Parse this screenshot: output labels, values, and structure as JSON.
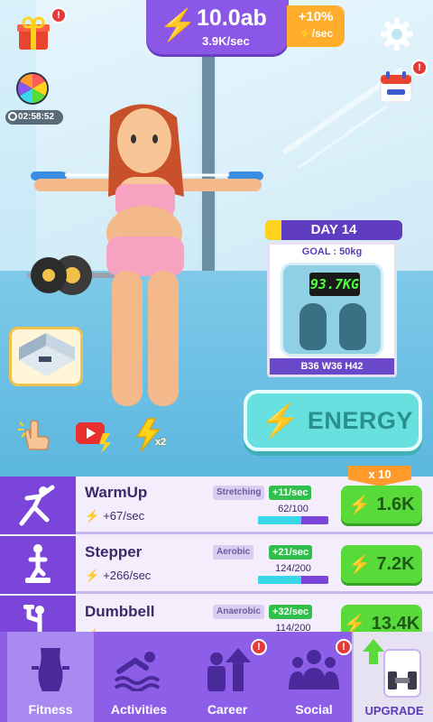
{
  "top_bar": {
    "energy_value": "10.0ab",
    "energy_rate": "3.9K/sec",
    "bonus_percent": "+10%",
    "bonus_per_sec": "/sec"
  },
  "timer": {
    "value": "02:58:52"
  },
  "day_card": {
    "day_label": "DAY 14",
    "day_progress_fraction": 0.12,
    "goal": "GOAL : 50kg",
    "scale_reading": "93.7KG",
    "measurements": "B36 W36 H42"
  },
  "energy_button": {
    "label": "ENERGY"
  },
  "multiplier": {
    "label": "x 10"
  },
  "mini_buttons": [
    {
      "name": "tap-boost",
      "text": ""
    },
    {
      "name": "video-boost",
      "text": ""
    },
    {
      "name": "x2-boost",
      "text": "x2"
    }
  ],
  "exercises": [
    {
      "name": "WarmUp",
      "rate": "+67/sec",
      "category": "Stretching",
      "bonus": "+11/sec",
      "progress": "62/100",
      "progress_fraction": 0.62,
      "cost": "1.6K"
    },
    {
      "name": "Stepper",
      "rate": "+266/sec",
      "category": "Aerobic",
      "bonus": "+21/sec",
      "progress": "124/200",
      "progress_fraction": 0.62,
      "cost": "7.2K"
    },
    {
      "name": "Dumbbell",
      "rate": "",
      "category": "Anaerobic",
      "bonus": "+32/sec",
      "progress": "114/200",
      "progress_fraction": 0.57,
      "cost": "13.4K"
    }
  ],
  "nav": {
    "tabs": [
      {
        "label": "Fitness",
        "active": true,
        "alert": false
      },
      {
        "label": "Activities",
        "active": false,
        "alert": false
      },
      {
        "label": "Career",
        "active": false,
        "alert": true
      },
      {
        "label": "Social",
        "active": false,
        "alert": true
      }
    ],
    "upgrade_label": "UPGRADE"
  },
  "colors": {
    "purple": "#8d5fe8",
    "accent": "#ffd21c",
    "energy": "#69e0e0",
    "buy": "#58db3a"
  }
}
